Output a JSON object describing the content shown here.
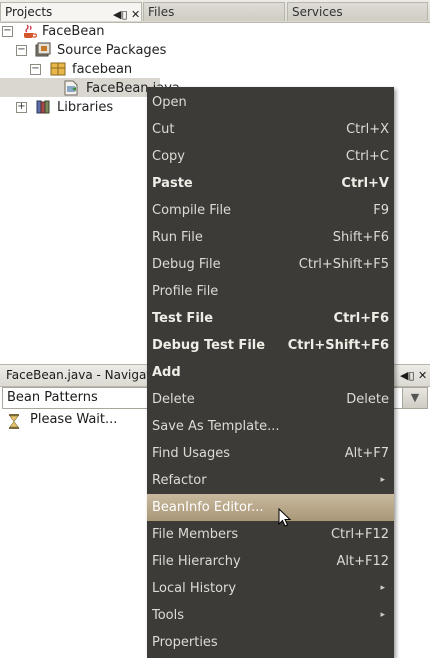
{
  "tabs": {
    "projects": "Projects",
    "files": "Files",
    "services": "Services",
    "controls": "◀▯ ✕"
  },
  "tree": {
    "root": "FaceBean",
    "source_packages": "Source Packages",
    "package": "facebean",
    "file": "FaceBean.java",
    "libraries": "Libraries",
    "expand_minus": "−",
    "expand_plus": "+"
  },
  "navigator": {
    "title": "FaceBean.java - Navigator",
    "controls": "◀▯ ✕",
    "filter_selected": "Bean Patterns",
    "status": "Please Wait..."
  },
  "context_menu": {
    "items": [
      {
        "label": "Open",
        "accel": ""
      },
      {
        "label": "Cut",
        "accel": "Ctrl+X"
      },
      {
        "label": "Copy",
        "accel": "Ctrl+C"
      },
      {
        "label": "Paste",
        "accel": "Ctrl+V"
      },
      {
        "label": "Compile File",
        "accel": "F9"
      },
      {
        "label": "Run File",
        "accel": "Shift+F6"
      },
      {
        "label": "Debug File",
        "accel": "Ctrl+Shift+F5"
      },
      {
        "label": "Profile File",
        "accel": ""
      },
      {
        "label": "Test File",
        "accel": "Ctrl+F6"
      },
      {
        "label": "Debug Test File",
        "accel": "Ctrl+Shift+F6"
      },
      {
        "label": "Add",
        "accel": ""
      },
      {
        "label": "Delete",
        "accel": "Delete"
      },
      {
        "label": "Save As Template...",
        "accel": ""
      },
      {
        "label": "Find Usages",
        "accel": "Alt+F7"
      },
      {
        "label": "Refactor",
        "accel": ""
      },
      {
        "label": "BeanInfo Editor...",
        "accel": ""
      },
      {
        "label": "File Members",
        "accel": "Ctrl+F12"
      },
      {
        "label": "File Hierarchy",
        "accel": "Alt+F12"
      },
      {
        "label": "Local History",
        "accel": ""
      },
      {
        "label": "Tools",
        "accel": ""
      },
      {
        "label": "Properties",
        "accel": ""
      }
    ],
    "submenu_arrow": "▸",
    "highlighted": "BeanInfo Editor..."
  },
  "colors": {
    "menu_bg": "#3c3b37",
    "menu_text": "#dedbd4",
    "menu_highlight": "#b9a88a"
  }
}
